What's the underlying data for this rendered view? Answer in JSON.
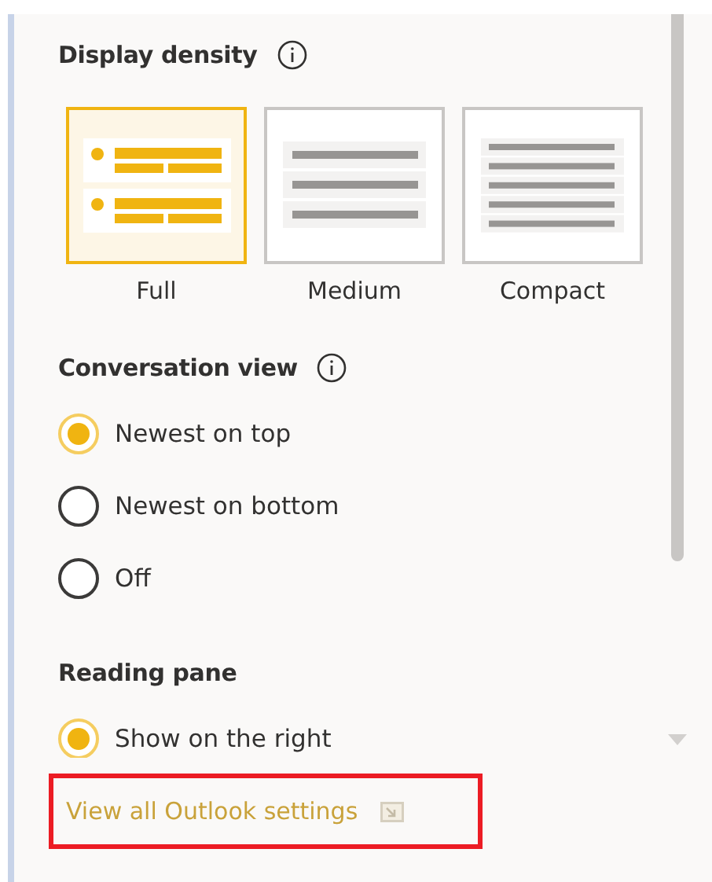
{
  "sections": [
    {
      "kind": "density",
      "title": "Display density",
      "info": true,
      "options": [
        {
          "label": "Full",
          "selected": true
        },
        {
          "label": "Medium",
          "selected": false
        },
        {
          "label": "Compact",
          "selected": false
        }
      ]
    },
    {
      "kind": "radios",
      "title": "Conversation view",
      "info": true,
      "options": [
        {
          "label": "Newest on top",
          "selected": true
        },
        {
          "label": "Newest on bottom",
          "selected": false
        },
        {
          "label": "Off",
          "selected": false
        }
      ]
    },
    {
      "kind": "radios",
      "title": "Reading pane",
      "options": [
        {
          "label": "Show on the right",
          "selected": true,
          "dropdown": true
        }
      ]
    }
  ],
  "footer_link": {
    "label": "View all Outlook settings",
    "highlighted": true
  }
}
